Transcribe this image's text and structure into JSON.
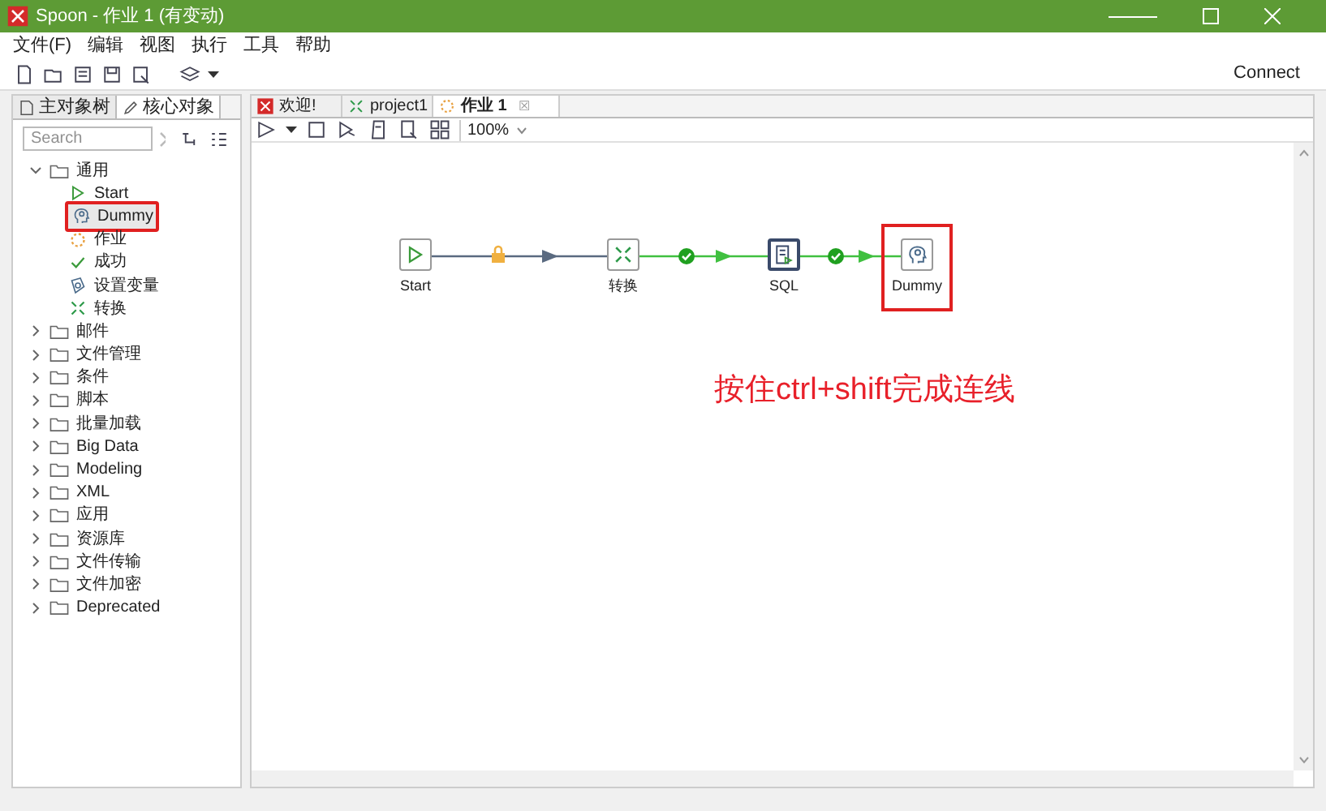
{
  "window": {
    "title": "Spoon - 作业 1 (有变动)"
  },
  "menu": [
    {
      "label": "文件(F)"
    },
    {
      "label": "编辑"
    },
    {
      "label": "视图"
    },
    {
      "label": "执行"
    },
    {
      "label": "工具"
    },
    {
      "label": "帮助"
    }
  ],
  "toolbar": {
    "connect": "Connect"
  },
  "left_tabs": [
    {
      "label": "主对象树",
      "kind": "tree",
      "selected": false
    },
    {
      "label": "核心对象",
      "kind": "pencil",
      "selected": true
    }
  ],
  "search": {
    "placeholder": "Search"
  },
  "tree": [
    {
      "label": "通用",
      "expanded": true,
      "children": [
        {
          "label": "Start",
          "kind": "start",
          "highlighted": false
        },
        {
          "label": "Dummy",
          "kind": "dummy",
          "highlighted": true
        },
        {
          "label": "作业",
          "kind": "job",
          "highlighted": false
        },
        {
          "label": "成功",
          "kind": "success",
          "highlighted": false
        },
        {
          "label": "设置变量",
          "kind": "variable",
          "highlighted": false
        },
        {
          "label": "转换",
          "kind": "transform",
          "highlighted": false
        }
      ]
    },
    {
      "label": "邮件",
      "expanded": false
    },
    {
      "label": "文件管理",
      "expanded": false
    },
    {
      "label": "条件",
      "expanded": false
    },
    {
      "label": "脚本",
      "expanded": false
    },
    {
      "label": "批量加载",
      "expanded": false
    },
    {
      "label": "Big Data",
      "expanded": false
    },
    {
      "label": "Modeling",
      "expanded": false
    },
    {
      "label": "XML",
      "expanded": false
    },
    {
      "label": "应用",
      "expanded": false
    },
    {
      "label": "资源库",
      "expanded": false
    },
    {
      "label": "文件传输",
      "expanded": false
    },
    {
      "label": "文件加密",
      "expanded": false
    },
    {
      "label": "Deprecated",
      "expanded": false
    }
  ],
  "editor_tabs": [
    {
      "label": "欢迎!",
      "kind": "welcome",
      "selected": false
    },
    {
      "label": "project1",
      "kind": "transform",
      "selected": false
    },
    {
      "label": "作业 1",
      "kind": "job",
      "selected": true,
      "close": "☒"
    }
  ],
  "zoom": {
    "value": "100%"
  },
  "canvas": {
    "nodes": [
      {
        "label": "Start",
        "kind": "start",
        "highlighted": false
      },
      {
        "label": "转换",
        "kind": "transform",
        "highlighted": false
      },
      {
        "label": "SQL",
        "kind": "sql",
        "highlighted": false
      },
      {
        "label": "Dummy",
        "kind": "dummy",
        "highlighted": true
      }
    ],
    "hops": [
      {
        "kind": "locked"
      },
      {
        "kind": "ok"
      },
      {
        "kind": "ok"
      }
    ],
    "annotation": "按住ctrl+shift完成连线"
  }
}
